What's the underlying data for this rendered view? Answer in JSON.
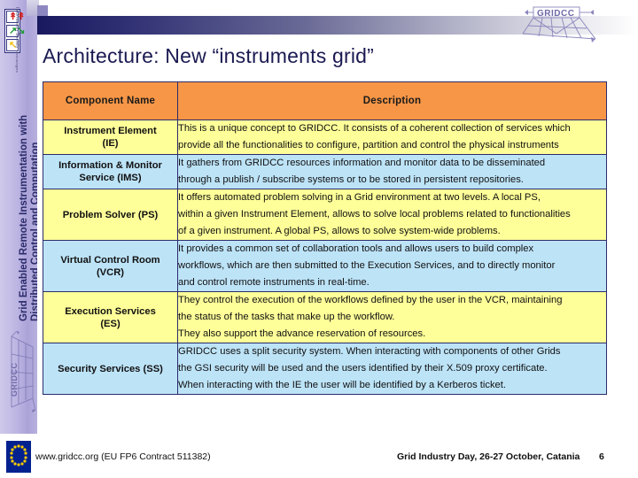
{
  "slide": {
    "title": "Architecture: New “instruments grid”",
    "accent_orange": "#f79646",
    "row_yellow": "#ffff99",
    "row_blue": "#bde3f7",
    "title_color": "#1a1a52",
    "header_gradient_start": "#191960",
    "header_gradient_end": "#ffffff"
  },
  "sidebar": {
    "vertical_text_line1": "Grid Enabled Remote Instrumentation with",
    "vertical_text_line2": "Distributed Control and Computation",
    "logo_text": "GRIDCC",
    "ist_label_main": "Information Society",
    "ist_label_sub": "Technologies"
  },
  "brand": {
    "gridcc_top_text": "GRIDCC"
  },
  "table": {
    "headers": {
      "component": "Component Name",
      "description": "Description"
    },
    "rows": [
      {
        "name_line1": "Instrument Element",
        "name_line2": "(IE)",
        "color": "yellow",
        "description": [
          "This is a unique concept to GRIDCC. It consists of a coherent collection of services which",
          "provide all the functionalities to configure, partition and control the physical instruments"
        ]
      },
      {
        "name_line1": "Information & Monitor",
        "name_line2": "Service (IMS)",
        "color": "blue",
        "description": [
          "It gathers from GRIDCC resources information and monitor data to be disseminated",
          "through a publish / subscribe systems or to be stored in persistent repositories."
        ]
      },
      {
        "name_line1": "Problem Solver (PS)",
        "name_line2": "",
        "color": "yellow",
        "description": [
          "It offers automated problem solving in a Grid environment at two levels. A local PS,",
          "within a given Instrument Element, allows to solve local problems related to functionalities",
          "of a given instrument. A global PS, allows to solve system-wide problems."
        ]
      },
      {
        "name_line1": "Virtual Control Room",
        "name_line2": "(VCR)",
        "color": "blue",
        "description": [
          "It provides a common set of collaboration tools and allows users to build complex",
          "workflows, which are then submitted to the Execution Services, and to directly monitor",
          "and control remote instruments in real-time."
        ]
      },
      {
        "name_line1": "Execution Services",
        "name_line2": "(ES)",
        "color": "yellow",
        "description": [
          "They control the execution of the workflows defined by the user in the VCR, maintaining",
          "the status of the tasks that make up the workflow.",
          "They also support the advance reservation of resources."
        ]
      },
      {
        "name_line1": "Security Services (SS)",
        "name_line2": "",
        "color": "blue",
        "description": [
          "GRIDCC uses a split security system. When interacting with components of other Grids",
          "the GSI security will be used and the users identified by their X.509 proxy certificate.",
          "When interacting with the IE the user will be identified by a Kerberos ticket."
        ]
      }
    ]
  },
  "footer": {
    "left_text": "www.gridcc.org (EU FP6 Contract 511382)",
    "right_text": "Grid Industry Day, 26-27 October, Catania",
    "page_number": "6"
  }
}
